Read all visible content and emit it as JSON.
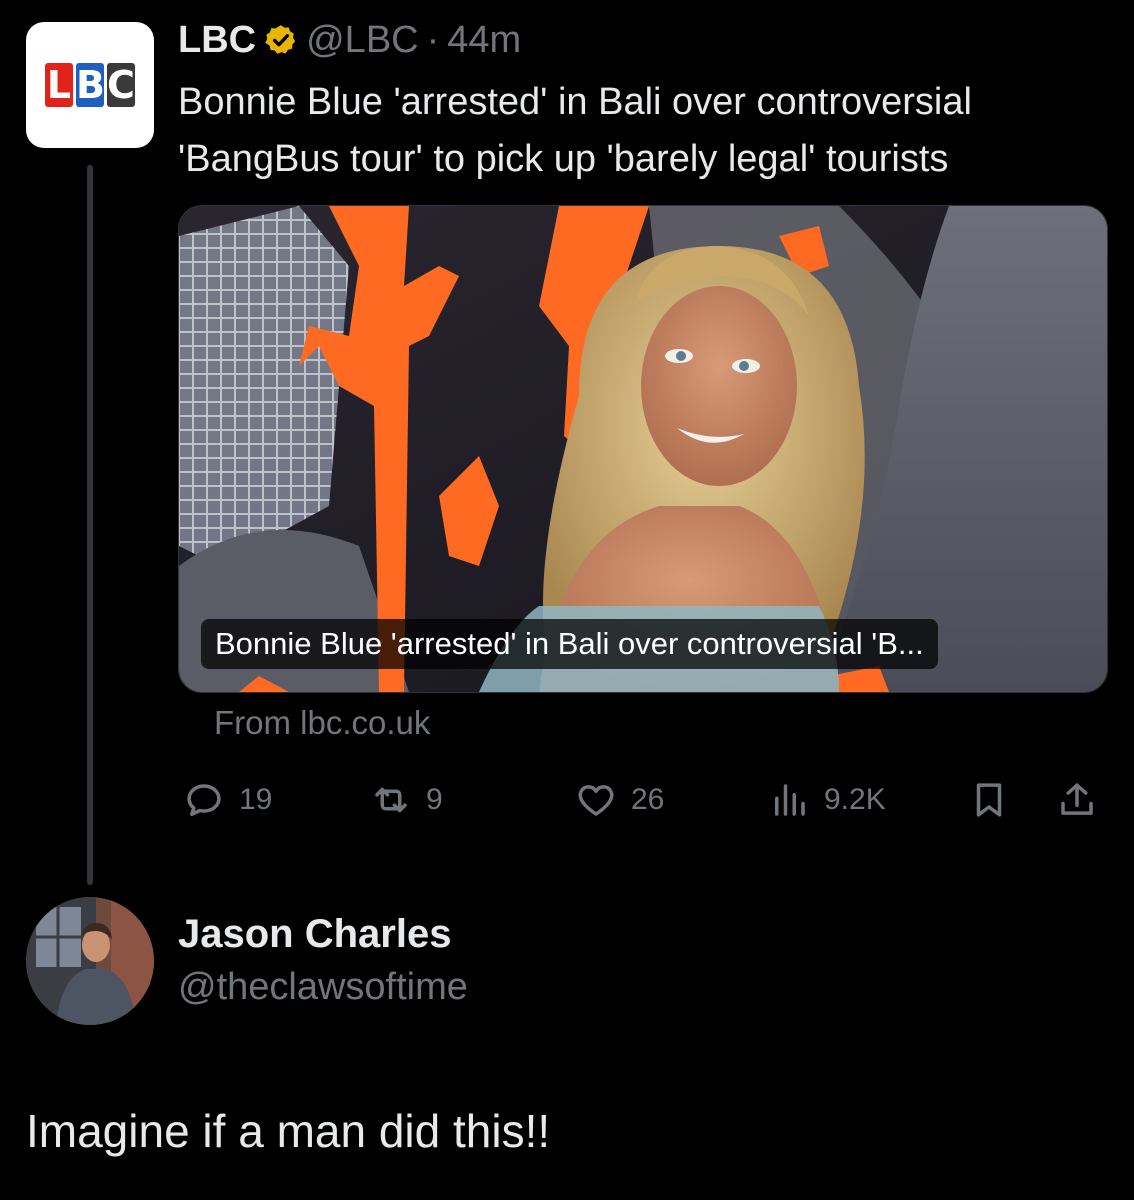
{
  "tweet": {
    "author": {
      "display_name": "LBC",
      "handle": "@LBC",
      "separator": "·",
      "time": "44m",
      "verified_icon": "verified-gold-badge",
      "avatar_letters": [
        "L",
        "B",
        "C"
      ]
    },
    "text": "Bonnie Blue 'arrested' in Bali over controversial 'BangBus tour' to pick up 'barely legal' tourists",
    "card": {
      "caption": "Bonnie Blue 'arrested' in Bali over controversial 'B...",
      "source": "From lbc.co.uk"
    },
    "actions": {
      "replies": "19",
      "reposts": "9",
      "likes": "26",
      "views": "9.2K"
    }
  },
  "reply": {
    "author": {
      "display_name": "Jason Charles",
      "handle": "@theclawsoftime"
    },
    "text": "Imagine if a man did this!!"
  },
  "colors": {
    "background": "#000000",
    "primary_text": "#e7e9ea",
    "secondary_text": "#71767b",
    "verified_gold": "#e8b500"
  }
}
